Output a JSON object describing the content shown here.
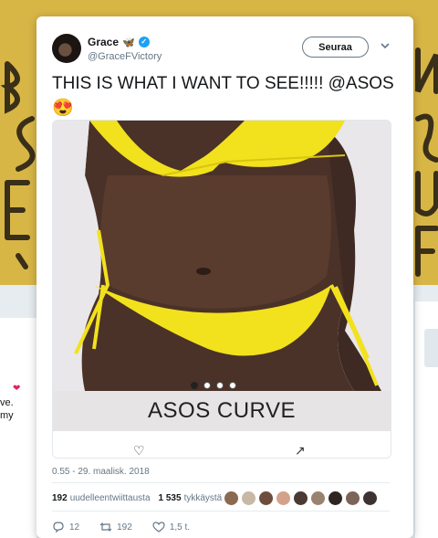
{
  "tweet": {
    "display_name": "Grace",
    "name_emoji": "🦋",
    "handle": "@GraceFVictory",
    "follow_label": "Seuraa",
    "text": "THIS IS WHAT I WANT TO SEE!!!!! @ASOS 😍",
    "emoji_line": [
      "😩",
      "🙌🏽",
      "😍",
      "😩",
      "🙌🏽",
      "😍",
      "😩",
      "🙌🏽"
    ],
    "media": {
      "caption": "ASOS CURVE",
      "carousel_count": 4,
      "active_index": 0
    },
    "timestamp": "0.55 - 29. maalisk. 2018",
    "retweets_count": "192",
    "retweets_label": "uudelleentwiittausta",
    "likes_count": "1 535",
    "likes_label": "tykkäystä",
    "reply_count": "12",
    "retweet_count": "192",
    "like_count": "1,5 t."
  },
  "background": {
    "left_text_lines": [
      "ve.",
      "my"
    ]
  },
  "colors": {
    "accent": "#1da1f2",
    "bikini": "#f2e11d",
    "background_banner": "#d8b646"
  }
}
